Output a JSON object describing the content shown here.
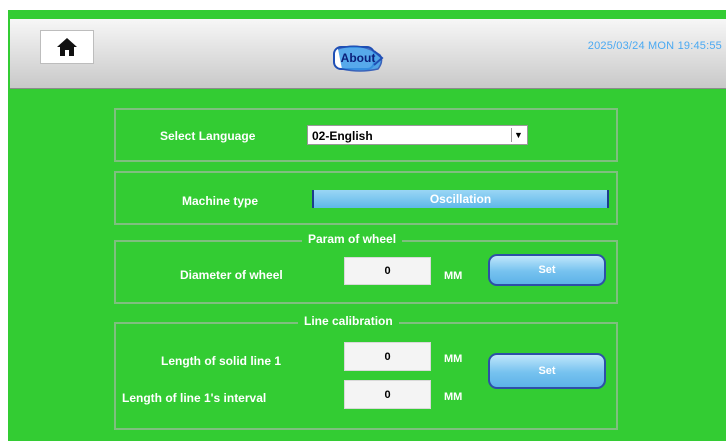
{
  "header": {
    "about_label": "About",
    "datetime": "2025/03/24 MON 19:45:55"
  },
  "icons": {
    "home": "home-icon",
    "about": "about-icon"
  },
  "colors": {
    "background": "#33cc33",
    "accent": "#5fb8ea",
    "datetime": "#4aa9f2"
  },
  "language": {
    "label": "Select Language",
    "selected": "02-English"
  },
  "machine": {
    "label": "Machine type",
    "value": "Oscillation"
  },
  "wheel": {
    "title": "Param of wheel",
    "diameter_label": "Diameter of wheel",
    "diameter_value": "0",
    "unit": "MM",
    "set_label": "Set"
  },
  "calibration": {
    "title": "Line calibration",
    "solid_label": "Length of solid line 1",
    "solid_value": "0",
    "interval_label": "Length of line 1's interval",
    "interval_value": "0",
    "unit": "MM",
    "set_label": "Set"
  }
}
